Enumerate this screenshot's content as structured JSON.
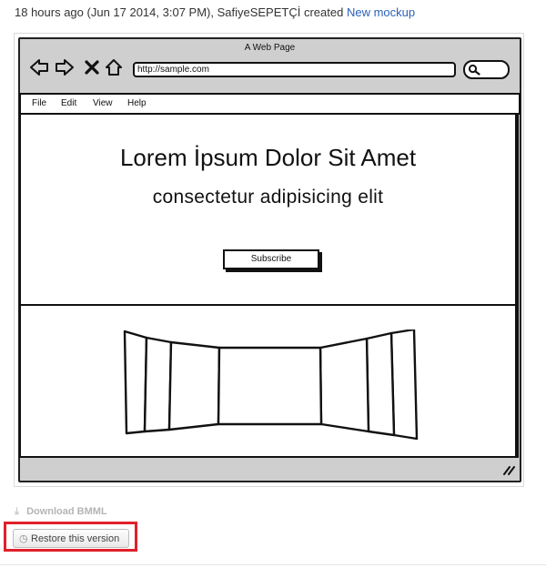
{
  "activity": {
    "time_text": "18 hours ago (Jun 17 2014, 3:07 PM), SafiyeSEPETÇİ created",
    "link_text": "New mockup"
  },
  "mockup": {
    "window_title": "A Web Page",
    "url": "http://sample.com",
    "menu": [
      "File",
      "Edit",
      "View",
      "Help"
    ],
    "headline": "Lorem İpsum Dolor Sit Amet",
    "subheadline": "consectetur adipisicing elit",
    "button_label": "Subscribe"
  },
  "actions": {
    "download_label": "Download BMML",
    "restore_label": "Restore this version"
  },
  "colors": {
    "link": "#2a62b8",
    "highlight": "#e0202b"
  }
}
